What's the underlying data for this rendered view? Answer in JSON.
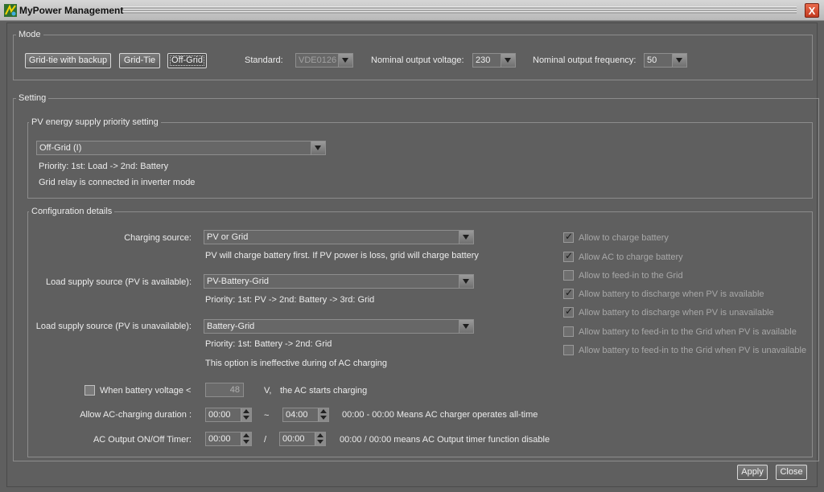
{
  "window": {
    "title": "MyPower Management",
    "close_label": "X"
  },
  "mode": {
    "legend": "Mode",
    "buttons": [
      "Grid-tie with backup",
      "Grid-Tie",
      "Off-Grid"
    ],
    "standard_label": "Standard:",
    "standard_value": "VDE0126",
    "voltage_label": "Nominal output voltage:",
    "voltage_value": "230",
    "frequency_label": "Nominal output frequency:",
    "frequency_value": "50"
  },
  "setting": {
    "legend": "Setting",
    "pv_priority": {
      "legend": "PV energy supply priority setting",
      "selected": "Off-Grid (I)",
      "priority_text": "Priority: 1st: Load -> 2nd: Battery",
      "relay_text": "Grid relay is connected in inverter mode"
    },
    "config": {
      "legend": "Configuration details",
      "charging_source": {
        "label": "Charging source:",
        "value": "PV or Grid",
        "note": "PV will charge battery first. If PV power is loss, grid will charge battery"
      },
      "load_pv_available": {
        "label": "Load supply source (PV is available):",
        "value": "PV-Battery-Grid",
        "note": "Priority: 1st: PV -> 2nd: Battery -> 3rd: Grid"
      },
      "load_pv_unavailable": {
        "label": "Load supply source (PV is unavailable):",
        "value": "Battery-Grid",
        "note": "Priority: 1st: Battery -> 2nd: Grid",
        "note2": "This option is ineffective during of AC charging"
      },
      "battery_voltage": {
        "label": "When battery voltage <",
        "value": "48",
        "unit": "V,",
        "suffix": "the AC starts charging",
        "checked": false
      },
      "ac_duration": {
        "label": "Allow AC-charging duration :",
        "start": "00:00",
        "sep": "~",
        "end": "04:00",
        "note": "00:00 - 00:00 Means AC charger operates all-time"
      },
      "ac_timer": {
        "label": "AC Output ON/Off Timer:",
        "on": "00:00",
        "sep": "/",
        "off": "00:00",
        "note": "00:00 / 00:00 means AC Output timer function disable"
      },
      "options": [
        {
          "label": "Allow to charge battery",
          "checked": true
        },
        {
          "label": "Allow AC to charge battery",
          "checked": true
        },
        {
          "label": "Allow to feed-in to the Grid",
          "checked": false
        },
        {
          "label": "Allow battery to discharge when PV is available",
          "checked": true
        },
        {
          "label": "Allow battery to discharge when PV is unavailable",
          "checked": true
        },
        {
          "label": "Allow battery to feed-in to the Grid when PV is available",
          "checked": false
        },
        {
          "label": "Allow battery to feed-in to the Grid when PV is unavailable",
          "checked": false
        }
      ]
    }
  },
  "footer": {
    "apply_label": "Apply",
    "close_label": "Close"
  }
}
